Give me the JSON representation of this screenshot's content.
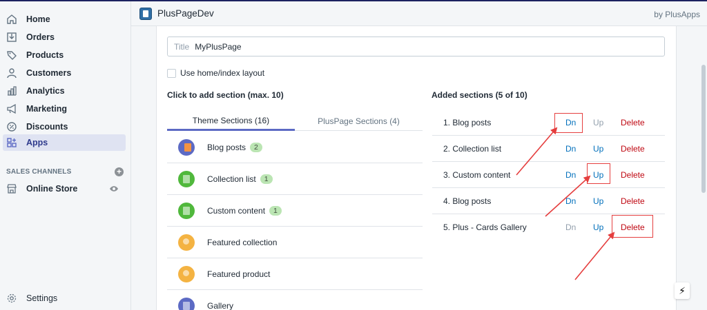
{
  "nav": {
    "items": [
      {
        "label": "Home",
        "icon": "home-icon"
      },
      {
        "label": "Orders",
        "icon": "orders-icon"
      },
      {
        "label": "Products",
        "icon": "tag-icon"
      },
      {
        "label": "Customers",
        "icon": "person-icon"
      },
      {
        "label": "Analytics",
        "icon": "bar-chart-icon"
      },
      {
        "label": "Marketing",
        "icon": "megaphone-icon"
      },
      {
        "label": "Discounts",
        "icon": "discount-icon"
      },
      {
        "label": "Apps",
        "icon": "apps-icon",
        "active": true
      }
    ],
    "channels_header": "SALES CHANNELS",
    "online_store": "Online Store",
    "settings": "Settings"
  },
  "header": {
    "app_title": "PlusPageDev",
    "by": "by PlusApps"
  },
  "form": {
    "title_prefix": "Title",
    "title_value": "MyPlusPage",
    "checkbox_label": "Use home/index layout"
  },
  "left": {
    "heading": "Click to add section (max. 10)",
    "tabs": [
      "Theme Sections (16)",
      "PlusPage Sections (4)"
    ],
    "sections": [
      {
        "name": "Blog posts",
        "badge": "2",
        "color": "purple"
      },
      {
        "name": "Collection list",
        "badge": "1",
        "color": "green"
      },
      {
        "name": "Custom content",
        "badge": "1",
        "color": "green"
      },
      {
        "name": "Featured collection",
        "badge": "",
        "color": "orange"
      },
      {
        "name": "Featured product",
        "badge": "",
        "color": "orange"
      },
      {
        "name": "Gallery",
        "badge": "",
        "color": "purple"
      }
    ]
  },
  "right": {
    "heading": "Added sections (5 of 10)",
    "dn_label": "Dn",
    "up_label": "Up",
    "delete_label": "Delete",
    "rows": [
      {
        "name": "1. Blog posts",
        "dn_enabled": true,
        "up_enabled": false
      },
      {
        "name": "2. Collection list",
        "dn_enabled": true,
        "up_enabled": true
      },
      {
        "name": "3. Custom content",
        "dn_enabled": true,
        "up_enabled": true
      },
      {
        "name": "4. Blog posts",
        "dn_enabled": true,
        "up_enabled": true
      },
      {
        "name": "5. Plus - Cards Gallery",
        "dn_enabled": false,
        "up_enabled": true
      }
    ]
  },
  "colors": {
    "accent": "#5c6ac4",
    "link": "#006fbb",
    "danger": "#bf0711",
    "annotation": "#e53e3e"
  }
}
